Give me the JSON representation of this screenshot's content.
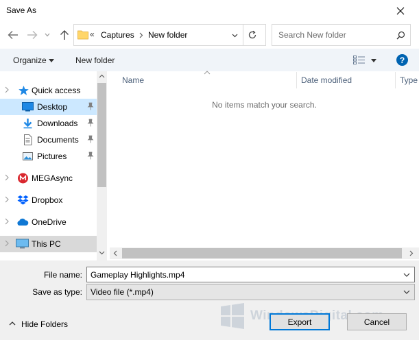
{
  "window": {
    "title": "Save As"
  },
  "address": {
    "overflow": "«",
    "crumbs": [
      "Captures",
      "New folder"
    ]
  },
  "search": {
    "placeholder": "Search New folder"
  },
  "toolbar": {
    "organize_label": "Organize",
    "new_folder_label": "New folder"
  },
  "nav": {
    "items": [
      {
        "label": "Quick access"
      },
      {
        "label": "Desktop"
      },
      {
        "label": "Downloads"
      },
      {
        "label": "Documents"
      },
      {
        "label": "Pictures"
      },
      {
        "label": "MEGAsync"
      },
      {
        "label": "Dropbox"
      },
      {
        "label": "OneDrive"
      },
      {
        "label": "This PC"
      }
    ]
  },
  "list": {
    "columns": [
      "Name",
      "Date modified",
      "Type"
    ],
    "empty_message": "No items match your search."
  },
  "form": {
    "filename_label": "File name:",
    "filename_value": "Gameplay Highlights.mp4",
    "type_label": "Save as type:",
    "type_value": "Video file (*.mp4)"
  },
  "footer": {
    "hide_folders_label": "Hide Folders",
    "export_label": "Export",
    "cancel_label": "Cancel"
  },
  "watermark": {
    "text": "WindowsDigital.com"
  },
  "colors": {
    "accent": "#0078d7",
    "selected": "#cce8ff",
    "folder": "#ffd66a"
  }
}
